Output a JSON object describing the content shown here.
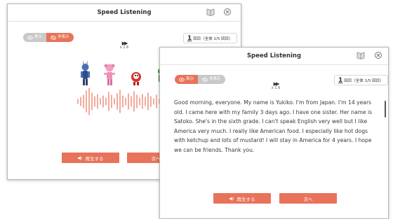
{
  "back_window": {
    "title": "Speed Listening",
    "toggle_show": "表示",
    "toggle_hide": "非表示",
    "page_number": "1",
    "page_suffix": "回目（全体 1/5 回目）",
    "speed_label": "x 1.6",
    "play_label": "再生する",
    "next_label": "次へ",
    "accent": "#e8735a"
  },
  "front_window": {
    "title": "Speed Listening",
    "toggle_show": "表示",
    "toggle_hide": "非表示",
    "page_number": "1",
    "page_suffix": "回目（全体 1/5 回目）",
    "speed_label": "x 1.6",
    "transcript": "Good morning, everyone. My name is Yukiko. I'm from Japan. I'm 14 years old. I came here with my family 3 days ago. I have one sister. Her name is Satoko. She's in the sixth grade. I can't speak English very well but I like America very much. I really like American food. I especially like hot dogs with ketchup and lots of mustard! I will stay in America for 4 years. I hope we can be friends. Thank you.",
    "play_label": "再生する",
    "next_label": "次へ"
  },
  "icons": {
    "book": "book-icon",
    "close": "close-icon",
    "eye": "eye-icon",
    "eye_off": "eye-off-icon",
    "fast_forward": "fast-forward-icon",
    "speaker": "speaker-icon"
  }
}
